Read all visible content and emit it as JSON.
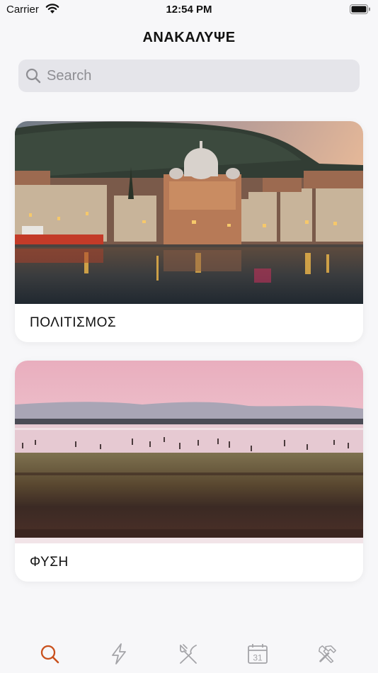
{
  "status_bar": {
    "carrier": "Carrier",
    "time": "12:54 PM"
  },
  "header": {
    "title": "ΑΝΑΚΑΛΥΨΕ"
  },
  "search": {
    "placeholder": "Search"
  },
  "categories": [
    {
      "label": "ΠΟΛΙΤΙΣΜΟΣ"
    },
    {
      "label": "ΦΥΣΗ"
    }
  ],
  "tabbar": {
    "active_color": "#c9501c",
    "inactive_color": "#a4a4a8",
    "tabs": [
      {
        "icon": "search-icon",
        "active": true
      },
      {
        "icon": "lightning-icon",
        "active": false
      },
      {
        "icon": "fork-knife-icon",
        "active": false
      },
      {
        "icon": "calendar-icon",
        "active": false,
        "number": "31"
      },
      {
        "icon": "tools-icon",
        "active": false
      }
    ]
  }
}
